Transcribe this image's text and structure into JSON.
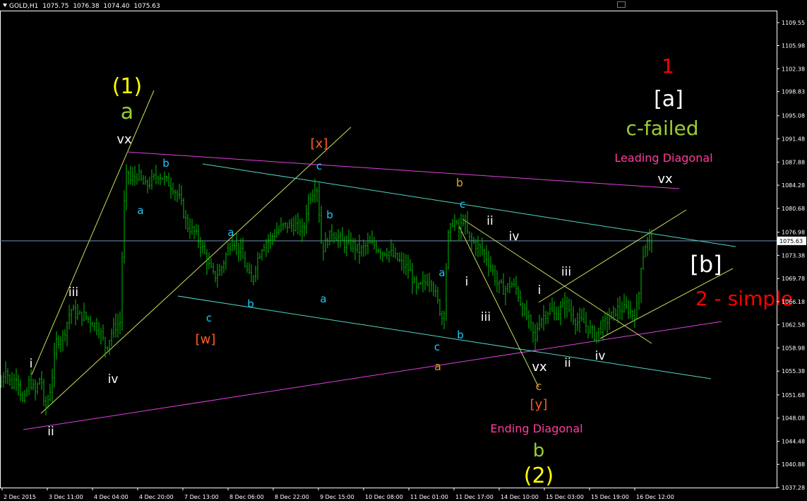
{
  "header": {
    "symbol": "GOLD,H1",
    "open": "1075.75",
    "high": "1076.38",
    "low": "1074.40",
    "close": "1075.63"
  },
  "colors": {
    "background": "#000000",
    "frame": "#ffffff",
    "candle": "#00c000",
    "trend_green": "#c8e15a",
    "channel_cyan": "#4fd6c4",
    "magenta": "#e040e0",
    "price_line": "#6f8fb4"
  },
  "chart_data": {
    "type": "candlestick",
    "symbol": "GOLD",
    "timeframe": "H1",
    "current_price": 1075.63,
    "ylim": [
      1036.4,
      1112.4
    ],
    "y_ticks": [
      1109.55,
      1105.98,
      1102.38,
      1098.83,
      1095.08,
      1091.48,
      1087.88,
      1084.28,
      1080.68,
      1076.98,
      1073.38,
      1069.78,
      1066.18,
      1062.58,
      1058.98,
      1055.38,
      1051.68,
      1048.08,
      1044.48,
      1040.88,
      1037.28
    ],
    "y_tick_labels": [
      "1109.55",
      "1105.98",
      "1102.38",
      "1098.83",
      "1095.08",
      "1091.48",
      "1087.88",
      "1084.28",
      "1080.68",
      "1076.98",
      "1073.38",
      "1069.78",
      "1066.18",
      "1062.58",
      "1058.98",
      "1055.38",
      "1051.68",
      "1048.08",
      "1044.48",
      "1040.88",
      "1037.28"
    ],
    "x_labels": [
      "2 Dec 2015",
      "3 Dec 11:00",
      "4 Dec 04:00",
      "4 Dec 20:00",
      "7 Dec 13:00",
      "8 Dec 06:00",
      "8 Dec 22:00",
      "9 Dec 15:00",
      "10 Dec 08:00",
      "11 Dec 01:00",
      "11 Dec 17:00",
      "14 Dec 10:00",
      "15 Dec 03:00",
      "15 Dec 19:00",
      "16 Dec 12:00"
    ],
    "price_path": [
      [
        0,
        1053
      ],
      [
        8,
        1056
      ],
      [
        16,
        1053
      ],
      [
        24,
        1055
      ],
      [
        33,
        1050
      ],
      [
        42,
        1054
      ],
      [
        50,
        1052
      ],
      [
        58,
        1055
      ],
      [
        62,
        1050
      ],
      [
        66,
        1050
      ],
      [
        72,
        1053
      ],
      [
        80,
        1060
      ],
      [
        90,
        1061
      ],
      [
        100,
        1065
      ],
      [
        110,
        1064
      ],
      [
        120,
        1064
      ],
      [
        130,
        1063
      ],
      [
        140,
        1062
      ],
      [
        150,
        1059
      ],
      [
        160,
        1062
      ],
      [
        170,
        1063
      ],
      [
        175,
        1080
      ],
      [
        180,
        1087
      ],
      [
        185,
        1085
      ],
      [
        195,
        1086
      ],
      [
        205,
        1084
      ],
      [
        215,
        1085
      ],
      [
        225,
        1086
      ],
      [
        235,
        1085
      ],
      [
        245,
        1084
      ],
      [
        255,
        1082
      ],
      [
        265,
        1078
      ],
      [
        275,
        1077
      ],
      [
        285,
        1075
      ],
      [
        295,
        1072
      ],
      [
        303,
        1070
      ],
      [
        312,
        1071
      ],
      [
        322,
        1074
      ],
      [
        330,
        1076
      ],
      [
        340,
        1074
      ],
      [
        350,
        1071
      ],
      [
        356,
        1069
      ],
      [
        362,
        1072
      ],
      [
        372,
        1075
      ],
      [
        382,
        1076
      ],
      [
        392,
        1077
      ],
      [
        402,
        1078
      ],
      [
        412,
        1078
      ],
      [
        420,
        1078
      ],
      [
        430,
        1077
      ],
      [
        436,
        1082
      ],
      [
        442,
        1083
      ],
      [
        448,
        1085
      ],
      [
        452,
        1080
      ],
      [
        456,
        1074
      ],
      [
        460,
        1075
      ],
      [
        470,
        1077
      ],
      [
        480,
        1076
      ],
      [
        490,
        1075
      ],
      [
        500,
        1075
      ],
      [
        510,
        1074
      ],
      [
        520,
        1075
      ],
      [
        530,
        1075
      ],
      [
        540,
        1074
      ],
      [
        550,
        1074
      ],
      [
        560,
        1073
      ],
      [
        570,
        1072
      ],
      [
        580,
        1071
      ],
      [
        590,
        1068
      ],
      [
        600,
        1069
      ],
      [
        610,
        1070
      ],
      [
        620,
        1066
      ],
      [
        628,
        1063
      ],
      [
        634,
        1076
      ],
      [
        642,
        1079
      ],
      [
        650,
        1077
      ],
      [
        656,
        1079
      ],
      [
        664,
        1076
      ],
      [
        674,
        1075
      ],
      [
        684,
        1074
      ],
      [
        694,
        1072
      ],
      [
        704,
        1069
      ],
      [
        714,
        1068
      ],
      [
        724,
        1069
      ],
      [
        732,
        1068
      ],
      [
        740,
        1065
      ],
      [
        750,
        1063
      ],
      [
        758,
        1060
      ],
      [
        762,
        1063
      ],
      [
        770,
        1064
      ],
      [
        778,
        1065
      ],
      [
        786,
        1064
      ],
      [
        794,
        1065
      ],
      [
        802,
        1066
      ],
      [
        810,
        1064
      ],
      [
        818,
        1063
      ],
      [
        826,
        1063
      ],
      [
        834,
        1062
      ],
      [
        842,
        1061
      ],
      [
        850,
        1062
      ],
      [
        858,
        1063
      ],
      [
        866,
        1064
      ],
      [
        874,
        1065
      ],
      [
        882,
        1065
      ],
      [
        890,
        1065
      ],
      [
        898,
        1064
      ],
      [
        904,
        1066
      ],
      [
        908,
        1072
      ],
      [
        914,
        1075
      ],
      [
        920,
        1076
      ],
      [
        925,
        1076
      ]
    ]
  },
  "labels": [
    {
      "text": "(1)",
      "color": "#ffff00",
      "size": 30
    },
    {
      "text": "a",
      "color": "#9acd32",
      "size": 30
    },
    {
      "text": "vx",
      "color": "#ffffff",
      "size": 18
    },
    {
      "text": "b",
      "color": "#1ec8ff",
      "size": 15
    },
    {
      "text": "a",
      "color": "#1ec8ff",
      "size": 15
    },
    {
      "text": "iii",
      "color": "#ffffff",
      "size": 17
    },
    {
      "text": "i",
      "color": "#ffffff",
      "size": 17
    },
    {
      "text": "iv",
      "color": "#ffffff",
      "size": 17
    },
    {
      "text": "ii",
      "color": "#ffffff",
      "size": 17
    },
    {
      "text": "a",
      "color": "#1ec8ff",
      "size": 15
    },
    {
      "text": "c",
      "color": "#1ec8ff",
      "size": 15
    },
    {
      "text": "[w]",
      "color": "#ff5e1f",
      "size": 18
    },
    {
      "text": "b",
      "color": "#1ec8ff",
      "size": 15
    },
    {
      "text": "[x]",
      "color": "#ff5e1f",
      "size": 18
    },
    {
      "text": "c",
      "color": "#1ec8ff",
      "size": 15
    },
    {
      "text": "b",
      "color": "#1ec8ff",
      "size": 15
    },
    {
      "text": "a",
      "color": "#1ec8ff",
      "size": 15
    },
    {
      "text": "b",
      "color": "#e09c28",
      "size": 16
    },
    {
      "text": "c",
      "color": "#1ec8ff",
      "size": 15
    },
    {
      "text": "ii",
      "color": "#ffffff",
      "size": 17
    },
    {
      "text": "iv",
      "color": "#ffffff",
      "size": 17
    },
    {
      "text": "a",
      "color": "#1ec8ff",
      "size": 15
    },
    {
      "text": "i",
      "color": "#ffffff",
      "size": 17
    },
    {
      "text": "iii",
      "color": "#ffffff",
      "size": 17
    },
    {
      "text": "b",
      "color": "#1ec8ff",
      "size": 15
    },
    {
      "text": "c",
      "color": "#1ec8ff",
      "size": 15
    },
    {
      "text": "a",
      "color": "#e09c28",
      "size": 16
    },
    {
      "text": "vx",
      "color": "#ffffff",
      "size": 18
    },
    {
      "text": "c",
      "color": "#e09c28",
      "size": 16
    },
    {
      "text": "[y]",
      "color": "#ff5e1f",
      "size": 18
    },
    {
      "text": "Ending Diagonal",
      "color": "#ff3c9c",
      "size": 16
    },
    {
      "text": "b",
      "color": "#9acd32",
      "size": 26
    },
    {
      "text": "(2)",
      "color": "#ffff00",
      "size": 30
    },
    {
      "text": "iii",
      "color": "#ffffff",
      "size": 17
    },
    {
      "text": "i",
      "color": "#ffffff",
      "size": 17
    },
    {
      "text": "ii",
      "color": "#ffffff",
      "size": 17
    },
    {
      "text": "iv",
      "color": "#ffffff",
      "size": 17
    },
    {
      "text": "1",
      "color": "#ff0000",
      "size": 28
    },
    {
      "text": "[a]",
      "color": "#ffffff",
      "size": 30
    },
    {
      "text": "c-failed",
      "color": "#9acd32",
      "size": 28
    },
    {
      "text": "Leading Diagonal",
      "color": "#ff3c9c",
      "size": 16
    },
    {
      "text": "vx",
      "color": "#ffffff",
      "size": 18
    },
    {
      "text": "[b]",
      "color": "#ffffff",
      "size": 32
    },
    {
      "text": "2 - simple",
      "color": "#ff0000",
      "size": 28
    }
  ]
}
